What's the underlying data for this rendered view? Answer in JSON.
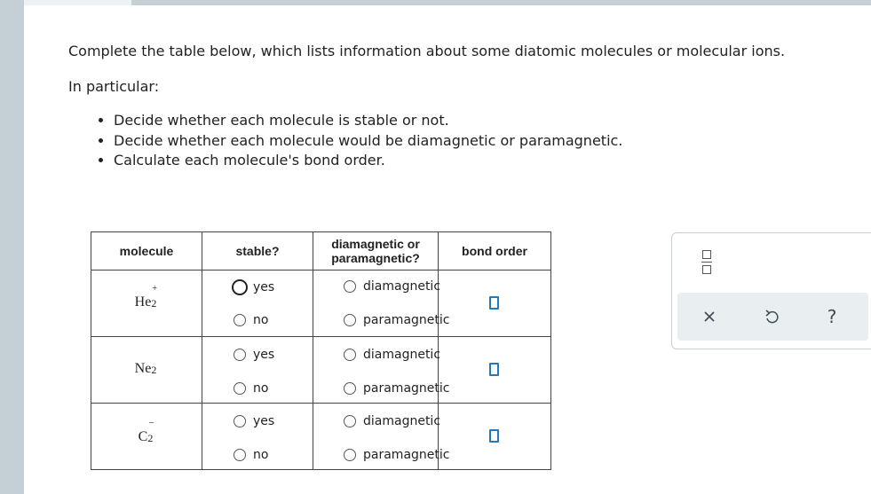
{
  "instructions": {
    "intro": "Complete the table below, which lists information about some diatomic molecules or molecular ions.",
    "particular": "In particular:",
    "bullets": [
      "Decide whether each molecule is stable or not.",
      "Decide whether each molecule would be diamagnetic or paramagnetic.",
      "Calculate each molecule's bond order."
    ]
  },
  "table": {
    "headers": {
      "molecule": "molecule",
      "stable": "stable?",
      "magnetic_line1": "diamagnetic or",
      "magnetic_line2": "paramagnetic?",
      "bond_order": "bond order"
    },
    "rows": [
      {
        "formula": "He",
        "subscript": "2",
        "charge": "+",
        "stable_yes": "yes",
        "stable_no": "no",
        "stable_selected": "yes",
        "dia": "diamagnetic",
        "para": "paramagnetic"
      },
      {
        "formula": "Ne",
        "subscript": "2",
        "charge": "",
        "stable_yes": "yes",
        "stable_no": "no",
        "stable_selected": "",
        "dia": "diamagnetic",
        "para": "paramagnetic"
      },
      {
        "formula": "C",
        "subscript": "2",
        "charge": "−",
        "stable_yes": "yes",
        "stable_no": "no",
        "stable_selected": "",
        "dia": "diamagnetic",
        "para": "paramagnetic"
      }
    ]
  },
  "tool_panel": {
    "icons": [
      "fraction-icon",
      "close-icon",
      "undo-icon",
      "help-icon"
    ],
    "help_symbol": "?",
    "accent_color": "#1f7ac0"
  }
}
